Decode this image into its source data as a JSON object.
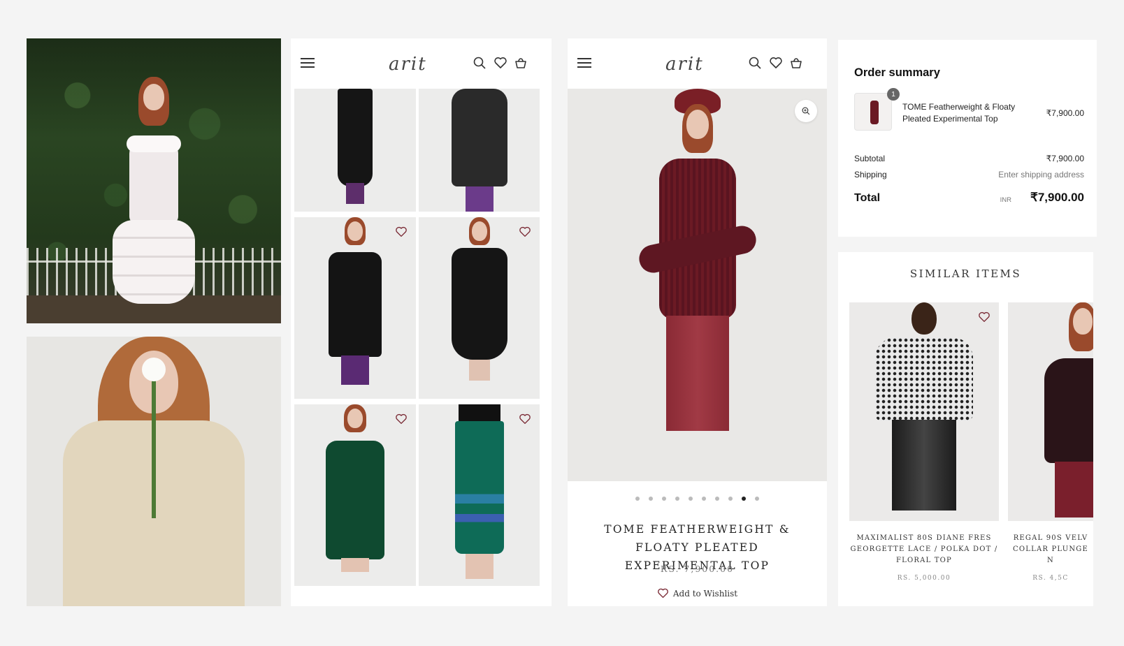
{
  "brand": {
    "logo_text": "arit"
  },
  "grid_header": {
    "menu_icon": "hamburger-menu-icon",
    "icons": [
      "search-icon",
      "heart-icon",
      "basket-icon"
    ]
  },
  "product": {
    "title": "TOME FEATHERWEIGHT & FLOATY PLEATED EXPERIMENTAL TOP",
    "price": "RS. 7,900.00",
    "wishlist_label": "Add to Wishlist",
    "gallery_dots": 10,
    "active_dot": 9
  },
  "order_summary": {
    "title": "Order summary",
    "item": {
      "quantity": "1",
      "name": "TOME Featherweight & Floaty Pleated Experimental Top",
      "price": "₹7,900.00"
    },
    "subtotal_label": "Subtotal",
    "subtotal_value": "₹7,900.00",
    "shipping_label": "Shipping",
    "shipping_value": "Enter shipping address",
    "total_label": "Total",
    "total_currency": "INR",
    "total_value": "₹7,900.00"
  },
  "similar_items": {
    "title": "SIMILAR ITEMS",
    "items": [
      {
        "name": "MAXIMALIST 80S DIANE FRES GEORGETTE LACE / POLKA DOT / FLORAL TOP",
        "price": "RS. 5,000.00"
      },
      {
        "name": "REGAL 90S VELV COLLAR PLUNGE N",
        "price": "RS. 4,5C"
      }
    ]
  },
  "colors": {
    "accent_maroon": "#6b1a24",
    "heart_outline": "#7a2a35",
    "background": "#f4f4f4"
  }
}
